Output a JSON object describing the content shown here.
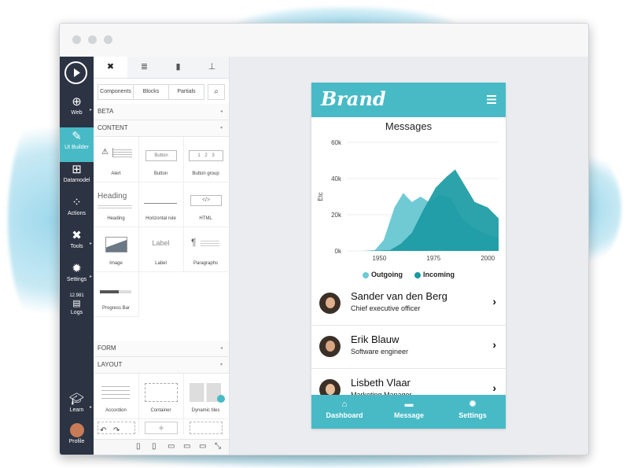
{
  "colors": {
    "accent": "#47bac6",
    "dark_teal": "#1a9aa3",
    "light_teal": "#6fcad4",
    "nav_bg": "#2c3343"
  },
  "nav": {
    "play_icon": "play-icon",
    "items": [
      {
        "label": "Web",
        "icon": "globe-icon"
      },
      {
        "label": "UI Builder",
        "icon": "brush-icon"
      },
      {
        "label": "Datamodel",
        "icon": "sitemap-icon"
      },
      {
        "label": "Actions",
        "icon": "actions-icon"
      },
      {
        "label": "Tools",
        "icon": "tools-icon"
      },
      {
        "label": "Settings",
        "icon": "gear-icon"
      },
      {
        "label": "Logs",
        "icon": "logs-icon",
        "badge": "12.981"
      },
      {
        "label": "Learn",
        "icon": "graduation-cap-icon"
      },
      {
        "label": "Profile",
        "icon": "avatar"
      }
    ]
  },
  "panel": {
    "segments": [
      "Components",
      "Blocks",
      "Partials"
    ],
    "sections": {
      "beta": "BETA",
      "content": "CONTENT",
      "form": "FORM",
      "layout": "LAYOUT"
    },
    "components": [
      {
        "label": "Alert"
      },
      {
        "label": "Button",
        "sample": "Button"
      },
      {
        "label": "Button group",
        "sample": "1 2 3"
      },
      {
        "label": "Heading",
        "sample": "Heading"
      },
      {
        "label": "Horizontal rule"
      },
      {
        "label": "HTML",
        "sample": "</>"
      },
      {
        "label": "Image"
      },
      {
        "label": "Label",
        "sample": "Label"
      },
      {
        "label": "Paragraphs",
        "sample": "¶"
      },
      {
        "label": "Progress Bar"
      }
    ],
    "layout_components": [
      {
        "label": "Accordion"
      },
      {
        "label": "Container"
      },
      {
        "label": "Dynamic tiles"
      }
    ]
  },
  "phone": {
    "brand": "Brand",
    "chart_title": "Messages",
    "people": [
      {
        "name": "Sander van den Berg",
        "role": "Chief executive officer"
      },
      {
        "name": "Erik Blauw",
        "role": "Software engineer"
      },
      {
        "name": "Lisbeth Vlaar",
        "role": "Marketing Manager"
      }
    ],
    "footer": [
      {
        "label": "Dashboard",
        "icon": "home-icon"
      },
      {
        "label": "Message",
        "icon": "message-icon"
      },
      {
        "label": "Settings",
        "icon": "gear-icon"
      }
    ]
  },
  "chart_data": {
    "type": "area",
    "title": "Messages",
    "ylabel": "Etc",
    "xlim": [
      1935,
      2005
    ],
    "ylim": [
      0,
      60000
    ],
    "x_ticks": [
      1950,
      1975,
      2000
    ],
    "y_ticks": [
      {
        "v": 0,
        "label": "0k"
      },
      {
        "v": 20000,
        "label": "20k"
      },
      {
        "v": 40000,
        "label": "40k"
      },
      {
        "v": 60000,
        "label": "60k"
      }
    ],
    "legend": "bottom",
    "series": [
      {
        "name": "Outgoing",
        "color": "#6fcad4",
        "points": [
          [
            1942,
            0
          ],
          [
            1948,
            500
          ],
          [
            1952,
            6000
          ],
          [
            1957,
            24000
          ],
          [
            1961,
            32000
          ],
          [
            1965,
            27000
          ],
          [
            1969,
            30000
          ],
          [
            1973,
            27000
          ],
          [
            1978,
            31000
          ],
          [
            1983,
            29000
          ],
          [
            1988,
            18000
          ],
          [
            1993,
            13000
          ],
          [
            1998,
            10000
          ],
          [
            2005,
            7000
          ]
        ]
      },
      {
        "name": "Incoming",
        "color": "#1a9aa3",
        "points": [
          [
            1945,
            0
          ],
          [
            1955,
            500
          ],
          [
            1960,
            4000
          ],
          [
            1965,
            10000
          ],
          [
            1970,
            22000
          ],
          [
            1976,
            35000
          ],
          [
            1981,
            41000
          ],
          [
            1985,
            45000
          ],
          [
            1989,
            37000
          ],
          [
            1994,
            27000
          ],
          [
            2000,
            24000
          ],
          [
            2005,
            18000
          ]
        ]
      }
    ]
  }
}
